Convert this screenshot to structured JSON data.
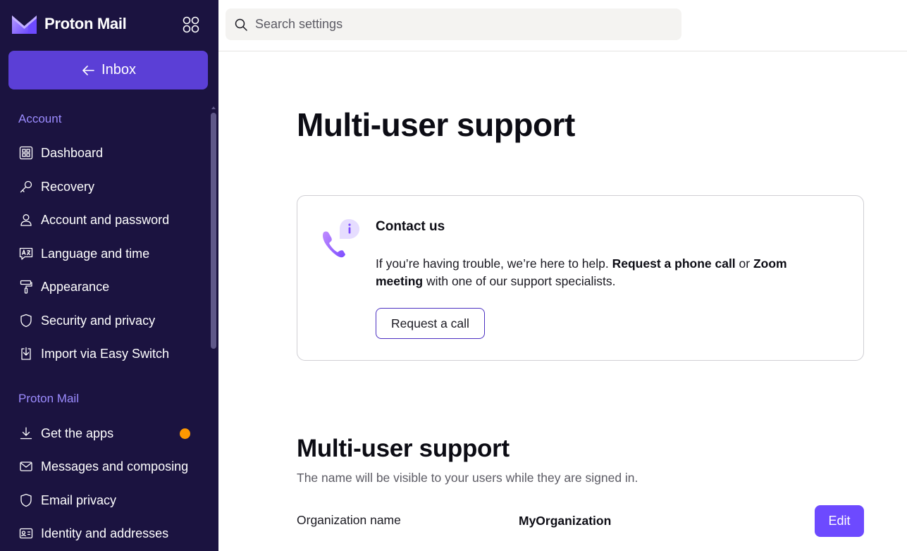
{
  "brand": {
    "name": "Proton Mail"
  },
  "inbox_button": {
    "label": "Inbox"
  },
  "sidebar": {
    "sections": [
      {
        "title": "Account",
        "items": [
          {
            "label": "Dashboard",
            "icon": "dashboard-icon"
          },
          {
            "label": "Recovery",
            "icon": "key-icon"
          },
          {
            "label": "Account and password",
            "icon": "user-icon"
          },
          {
            "label": "Language and time",
            "icon": "language-icon"
          },
          {
            "label": "Appearance",
            "icon": "paint-roller-icon"
          },
          {
            "label": "Security and privacy",
            "icon": "shield-icon"
          },
          {
            "label": "Import via Easy Switch",
            "icon": "import-icon"
          }
        ]
      },
      {
        "title": "Proton Mail",
        "items": [
          {
            "label": "Get the apps",
            "icon": "download-icon",
            "notification": true
          },
          {
            "label": "Messages and composing",
            "icon": "envelope-icon"
          },
          {
            "label": "Email privacy",
            "icon": "shield-icon"
          },
          {
            "label": "Identity and addresses",
            "icon": "id-card-icon"
          }
        ]
      }
    ]
  },
  "search": {
    "placeholder": "Search settings",
    "value": ""
  },
  "main": {
    "title": "Multi-user support",
    "contact_card": {
      "title": "Contact us",
      "text_1": "If you’re having trouble, we’re here to help. ",
      "bold_1": "Request a phone call",
      "text_2": " or ",
      "bold_2": "Zoom meeting",
      "text_3": " with one of our support specialists.",
      "button_label": "Request a call"
    },
    "section": {
      "title": "Multi-user support",
      "description": "The name will be visible to your users while they are signed in.",
      "field_label": "Organization name",
      "field_value": "MyOrganization",
      "edit_label": "Edit"
    }
  },
  "colors": {
    "sidebar_bg": "#1b1340",
    "accent": "#6d4aff",
    "section_title": "#9c8cff",
    "notification": "#ff9900"
  }
}
